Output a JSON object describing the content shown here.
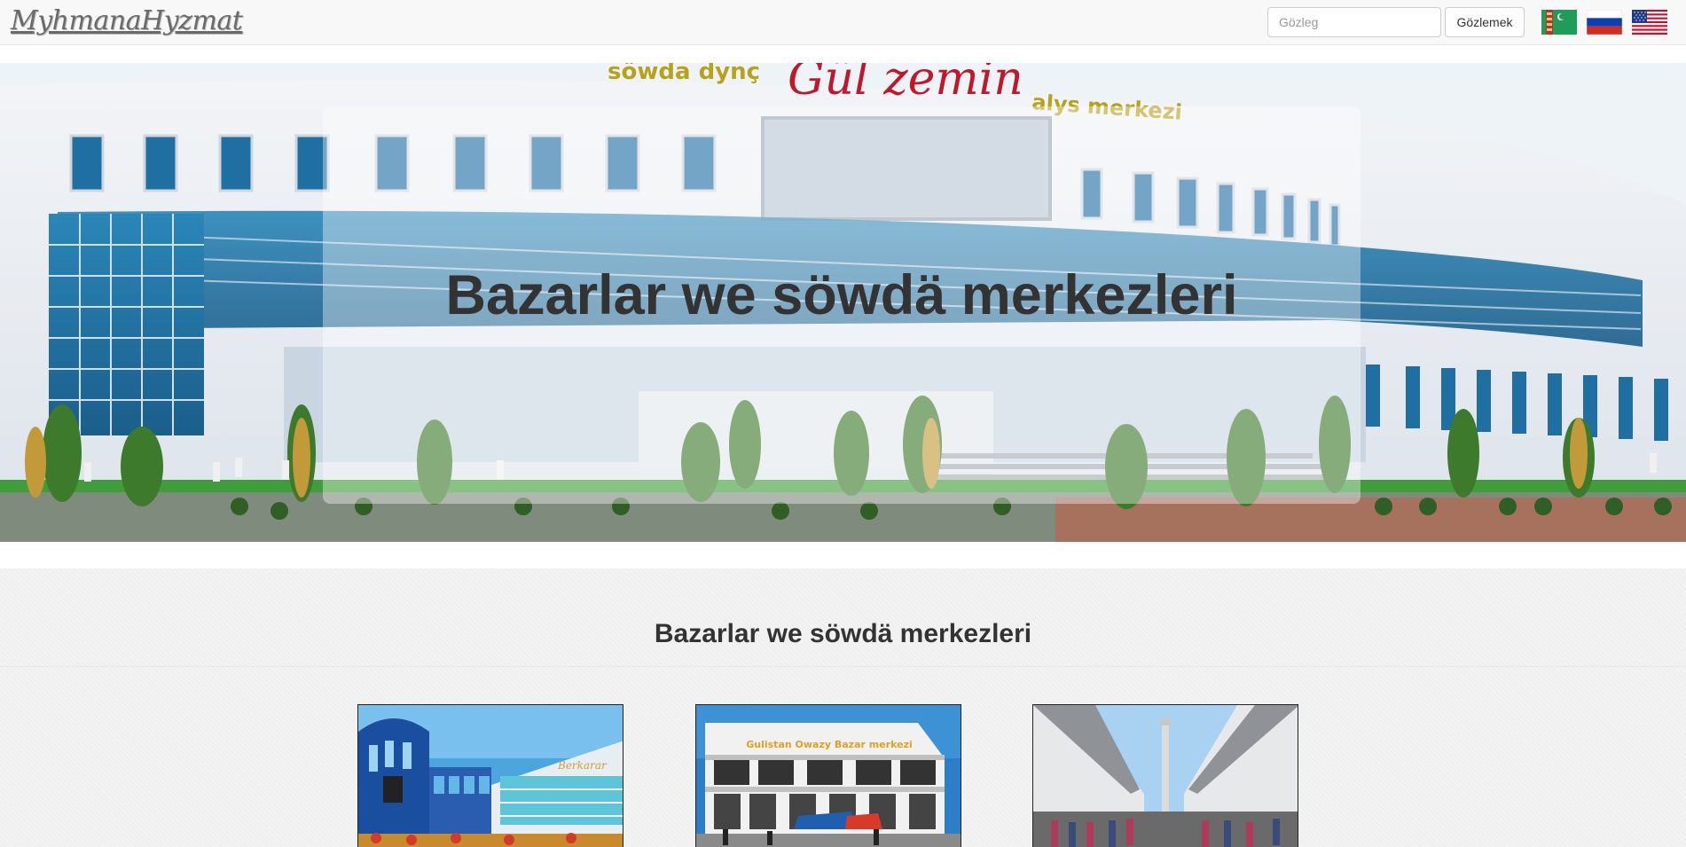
{
  "navbar": {
    "brand": "MyhmanaHyzmat",
    "search_placeholder": "Gözleg",
    "search_button": "Gözlemek",
    "languages": [
      "turkmen-flag-icon",
      "russian-flag-icon",
      "usa-flag-icon"
    ]
  },
  "hero": {
    "title": "Bazarlar we söwdä merkezleri",
    "sign_text_1": "söwda dynç",
    "sign_text_2": "Gül zemin",
    "sign_text_3": "alys merkezi"
  },
  "section": {
    "title": "Bazarlar we söwdä merkezleri",
    "cards": [
      {
        "image": "shopping-center-photo"
      },
      {
        "image": "market-building-photo",
        "sign": "Gulistan Owazy Bazar merkezi"
      },
      {
        "image": "covered-market-photo"
      }
    ]
  },
  "colors": {
    "navbar_bg": "#f8f8f8",
    "section_bg": "#f3f3f3",
    "text": "#333333"
  }
}
